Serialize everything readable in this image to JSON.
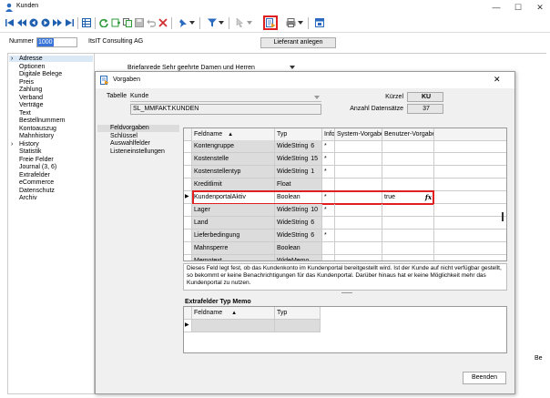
{
  "window": {
    "title": "Kunden"
  },
  "window_controls": {
    "minimize": "—",
    "maximize": "☐",
    "close": "✕"
  },
  "header": {
    "nummer_label": "Nummer",
    "nummer_value": "1000",
    "company": "ItsIT Consulting AG",
    "lieferant_button": "Lieferant anlegen"
  },
  "sidebar": {
    "items": [
      {
        "label": "Adresse",
        "expand": "›"
      },
      {
        "label": "Optionen"
      },
      {
        "label": "Digitale Belege"
      },
      {
        "label": "Preis"
      },
      {
        "label": "Zahlung"
      },
      {
        "label": "Verband"
      },
      {
        "label": "Verträge"
      },
      {
        "label": "Text"
      },
      {
        "label": "Bestellnummern"
      },
      {
        "label": "Kontoauszug"
      },
      {
        "label": "Mahnhistory"
      },
      {
        "label": "History",
        "expand": "›"
      },
      {
        "label": "Statistik"
      },
      {
        "label": "Freie Felder"
      },
      {
        "label": "Journal (3, 6)"
      },
      {
        "label": "Extrafelder"
      },
      {
        "label": "eCommerce"
      },
      {
        "label": "Datenschutz"
      },
      {
        "label": "Archiv"
      }
    ]
  },
  "main": {
    "briefanrede_label": "Briefanrede",
    "briefanrede_value": "Sehr geehrte Damen und Herren",
    "right_edge_text": "Be"
  },
  "dialog": {
    "title": "Vorgaben",
    "close": "✕",
    "tabelle_label": "Tabelle",
    "tabelle_value": "Kunde",
    "tabelle_path": "SL_MMFAKT.KUNDEN",
    "kuerzel_label": "Kürzel",
    "kuerzel_value": "KU",
    "anzahl_label": "Anzahl Datensätze",
    "anzahl_value": "37",
    "left_nav": [
      {
        "label": "Feldvorgaben",
        "selected": true
      },
      {
        "label": "Schlüssel"
      },
      {
        "label": "Auswahlfelder"
      },
      {
        "label": "Listeneinstellungen"
      }
    ],
    "grid": {
      "headers": {
        "feldname": "Feldname",
        "sort": "▲",
        "typ": "Typ",
        "info": "Info",
        "system": "System-Vorgabe",
        "benutzer": "Benutzer-Vorgabe"
      },
      "rows": [
        {
          "feldname": "Kontengruppe",
          "typ": "WideString",
          "len": "6",
          "info": "*",
          "benutzer": ""
        },
        {
          "feldname": "Kostenstelle",
          "typ": "WideString",
          "len": "15",
          "info": "*",
          "benutzer": ""
        },
        {
          "feldname": "Kostenstellentyp",
          "typ": "WideString",
          "len": "1",
          "info": "*",
          "benutzer": ""
        },
        {
          "feldname": "Kreditlimit",
          "typ": "Float",
          "len": "",
          "info": "",
          "benutzer": ""
        },
        {
          "feldname": "KundenportalAktiv",
          "typ": "Boolean",
          "len": "",
          "info": "*",
          "benutzer": "true",
          "current": true
        },
        {
          "feldname": "Lager",
          "typ": "WideString",
          "len": "10",
          "info": "*",
          "benutzer": ""
        },
        {
          "feldname": "Land",
          "typ": "WideString",
          "len": "6",
          "info": "",
          "benutzer": ""
        },
        {
          "feldname": "Lieferbedingung",
          "typ": "WideString",
          "len": "6",
          "info": "*",
          "benutzer": ""
        },
        {
          "feldname": "Mahnsperre",
          "typ": "Boolean",
          "len": "",
          "info": "",
          "benutzer": ""
        },
        {
          "feldname": "Memotext",
          "typ": "WideMemo",
          "len": "",
          "info": "",
          "benutzer": ""
        }
      ],
      "row_indicator": "▶",
      "fx": "fx"
    },
    "description": "Dieses Feld legt fest, ob das Kundenkonto im Kundenportal bereitgestellt wird. Ist der Kunde auf nicht verfügbar gestellt, so bekommt er keine Benachrichtigungen für das Kundenportal. Darüber hinaus hat er keine Möglichkeit mehr das Kundenportal zu nutzen.",
    "extrafelder_title": "Extrafelder Typ Memo",
    "extra_grid": {
      "feldname": "Feldname",
      "sort": "▲",
      "typ": "Typ",
      "indicator": "▶"
    },
    "beenden_button": "Beenden"
  },
  "colors": {
    "highlight": "#e02020",
    "selection": "#dbe8f6"
  }
}
